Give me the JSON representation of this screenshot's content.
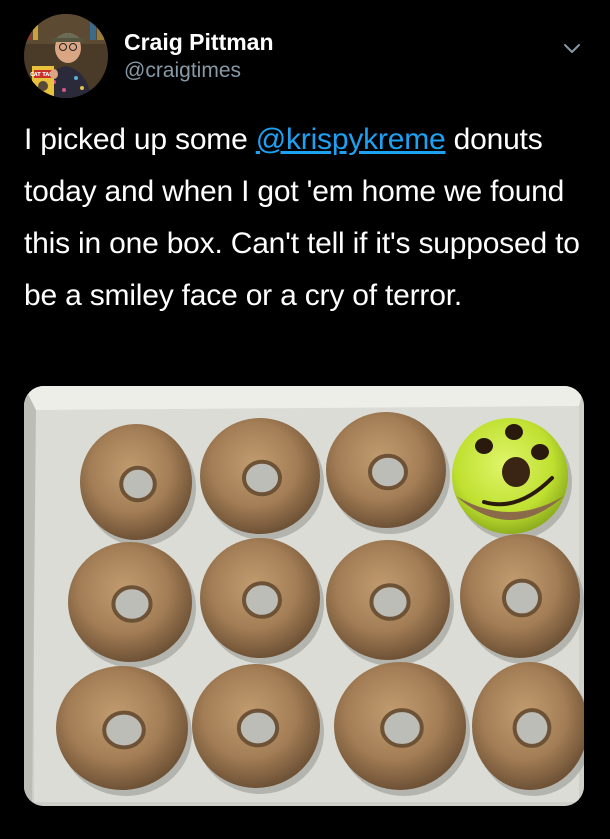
{
  "author": {
    "display_name": "Craig Pittman",
    "handle": "@craigtimes",
    "avatar_book_text": "CAT TALE"
  },
  "tweet": {
    "text_before": "I picked up some ",
    "mention": "@krispykreme",
    "text_after": " donuts today and when I got 'em home we found this in one box. Can't tell if it's supposed to be a smiley face or a cry of terror."
  },
  "media": {
    "alt": "Box of twelve glazed donuts, one with green icing and a face drawn on it",
    "box_color": "#d8d8d2",
    "donut_color": "#a8825a",
    "smiley_color": "#c4e63a"
  },
  "colors": {
    "background": "#000000",
    "link": "#1da1f2",
    "secondary_text": "#8899a6"
  }
}
